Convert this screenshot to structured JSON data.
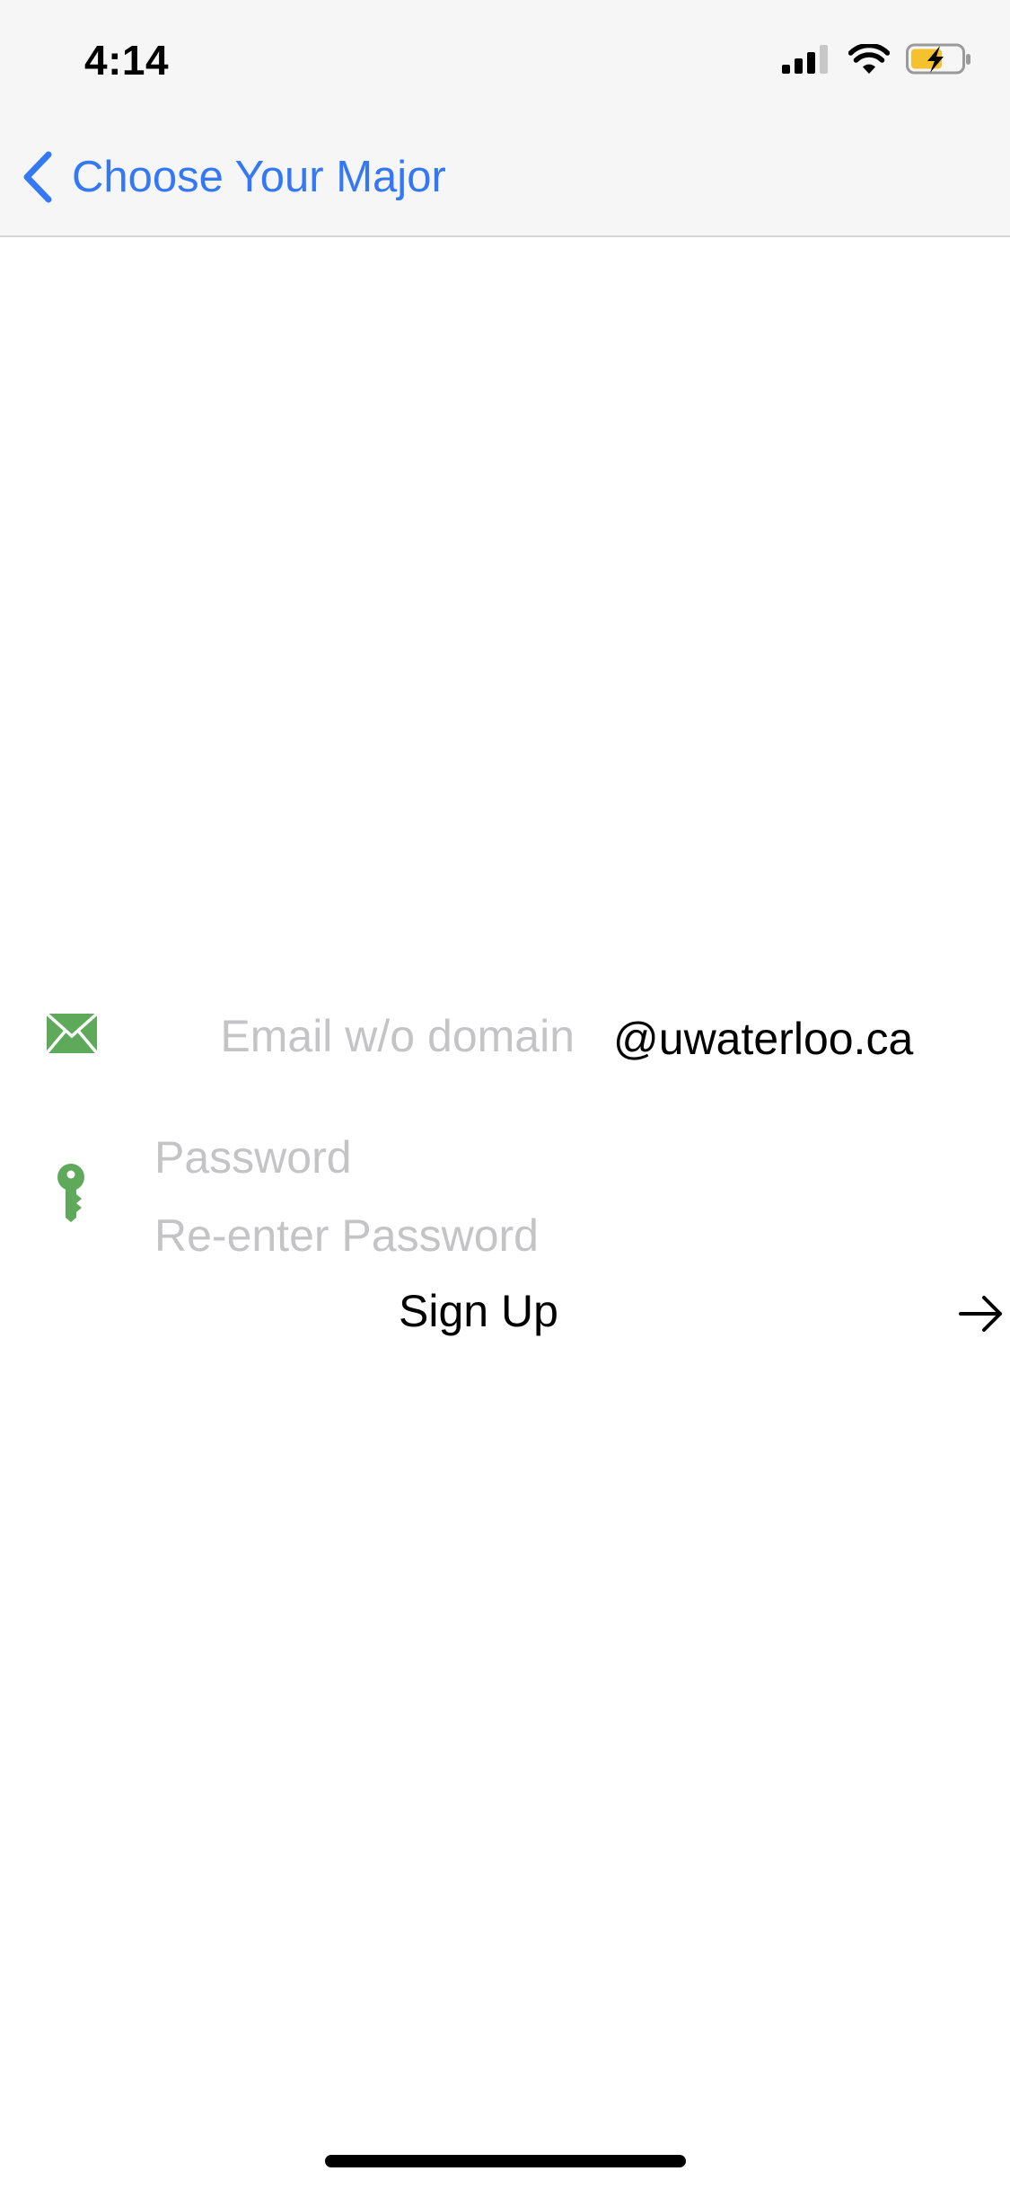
{
  "status_bar": {
    "time": "4:14",
    "icons": [
      "cellular-signal-icon",
      "wifi-icon",
      "battery-charging-icon"
    ],
    "battery_color": "#f5c12e"
  },
  "nav": {
    "back_label": "Choose Your Major",
    "back_icon": "chevron-left-icon",
    "accent_color": "#3478f6"
  },
  "form": {
    "email": {
      "icon": "mail-icon",
      "placeholder": "Email w/o domain",
      "value": "",
      "domain_suffix": "@uwaterloo.ca"
    },
    "password": {
      "icon": "key-icon",
      "placeholder": "Password",
      "value": ""
    },
    "password_confirm": {
      "placeholder": "Re-enter Password",
      "value": ""
    },
    "icon_color": "#5faa5a",
    "signup": {
      "label": "Sign Up",
      "icon": "arrow-right-icon"
    }
  }
}
